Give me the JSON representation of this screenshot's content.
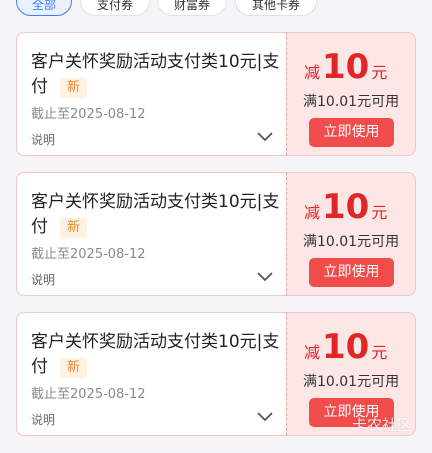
{
  "tabs": [
    {
      "label": "全部",
      "active": true
    },
    {
      "label": "支付券",
      "active": false
    },
    {
      "label": "财富券",
      "active": false
    },
    {
      "label": "其他卡券",
      "active": false
    }
  ],
  "coupons": [
    {
      "title": "客户关怀奖励活动支付类10元|支付",
      "badge": "新",
      "expiry": "截止至2025-08-12",
      "desc": "说明",
      "prefix": "减",
      "amount": "10",
      "unit": "元",
      "condition": "满10.01元可用",
      "button": "立即使用"
    },
    {
      "title": "客户关怀奖励活动支付类10元|支付",
      "badge": "新",
      "expiry": "截止至2025-08-12",
      "desc": "说明",
      "prefix": "减",
      "amount": "10",
      "unit": "元",
      "condition": "满10.01元可用",
      "button": "立即使用"
    },
    {
      "title": "客户关怀奖励活动支付类10元|支付",
      "badge": "新",
      "expiry": "截止至2025-08-12",
      "desc": "说明",
      "prefix": "减",
      "amount": "10",
      "unit": "元",
      "condition": "满10.01元可用",
      "button": "立即使用"
    }
  ],
  "watermark": "卡农社区",
  "colors": {
    "accent": "#f14c4c",
    "tab_active": "#3e7bfa",
    "badge_text": "#e58b2f"
  }
}
